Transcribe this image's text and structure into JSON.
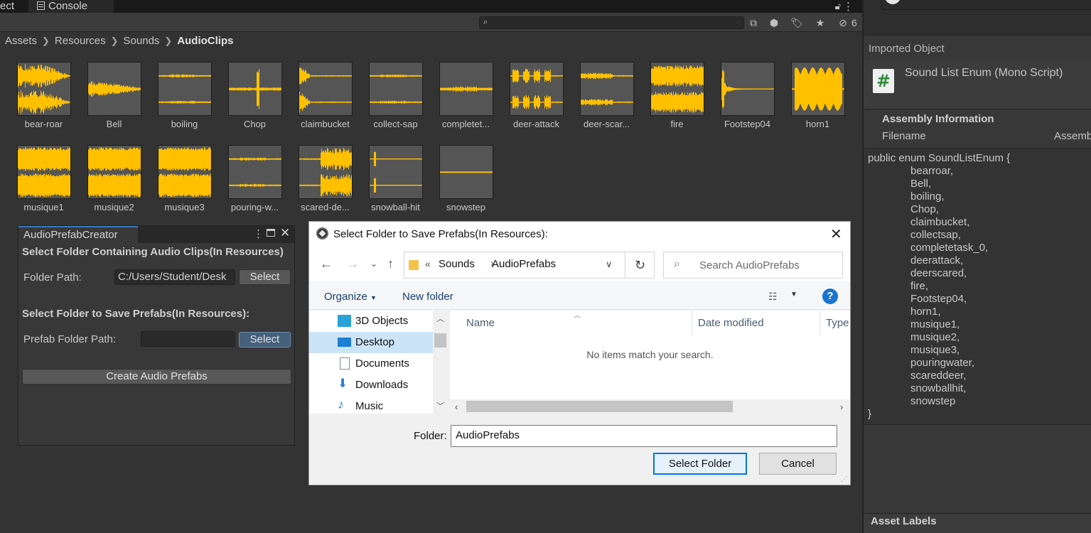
{
  "tabs": {
    "project": "ect",
    "console": "Console"
  },
  "toolbar": {
    "hidden_count": "6"
  },
  "breadcrumb": [
    "Assets",
    "Resources",
    "Sounds",
    "AudioClips"
  ],
  "audio_clips": [
    {
      "name": "bear-roar"
    },
    {
      "name": "Bell"
    },
    {
      "name": "boiling"
    },
    {
      "name": "Chop"
    },
    {
      "name": "claimbucket"
    },
    {
      "name": "collect-sap"
    },
    {
      "name": "completet..."
    },
    {
      "name": "deer-attack"
    },
    {
      "name": "deer-scar..."
    },
    {
      "name": "fire"
    },
    {
      "name": "Footstep04"
    },
    {
      "name": "horn1"
    },
    {
      "name": "musique1"
    },
    {
      "name": "musique2"
    },
    {
      "name": "musique3"
    },
    {
      "name": "pouring-w..."
    },
    {
      "name": "scared-de..."
    },
    {
      "name": "snowball-hit"
    },
    {
      "name": "snowstep"
    }
  ],
  "creator": {
    "tab": "AudioPrefabCreator",
    "heading1": "Select Folder Containing Audio Clips(In Resources)",
    "folder_label": "Folder Path:",
    "folder_value": "C:/Users/Student/Desk",
    "select1": "Select",
    "heading2": "Select Folder to Save Prefabs(In Resources):",
    "prefab_label": "Prefab Folder Path:",
    "prefab_value": "",
    "select2": "Select",
    "create": "Create Audio Prefabs"
  },
  "inspector": {
    "imported_object": "Imported Object",
    "script_title": "Sound List Enum (Mono Script)",
    "assembly_info": "Assembly Information",
    "filename": "Filename",
    "assembly_col": "Assemb",
    "code_open": "public enum SoundListEnum {",
    "code_items": [
      "bearroar,",
      "Bell,",
      "boiling,",
      "Chop,",
      "claimbucket,",
      "collectsap,",
      "completetask_0,",
      "deerattack,",
      "deerscared,",
      "fire,",
      "Footstep04,",
      "horn1,",
      "musique1,",
      "musique2,",
      "musique3,",
      "pouringwater,",
      "scareddeer,",
      "snowballhit,",
      "snowstep"
    ],
    "code_close": "}",
    "asset_labels": "Asset Labels"
  },
  "dialog": {
    "title": "Select Folder to Save Prefabs(In Resources):",
    "address": {
      "parent": "Sounds",
      "current": "AudioPrefabs"
    },
    "search_placeholder": "Search AudioPrefabs",
    "organize": "Organize",
    "new_folder": "New folder",
    "nav_items": [
      {
        "label": "3D Objects",
        "icon": "3d-objects-icon"
      },
      {
        "label": "Desktop",
        "icon": "desktop-icon"
      },
      {
        "label": "Documents",
        "icon": "documents-icon"
      },
      {
        "label": "Downloads",
        "icon": "downloads-icon"
      },
      {
        "label": "Music",
        "icon": "music-icon"
      }
    ],
    "columns": [
      "Name",
      "Date modified",
      "Type"
    ],
    "empty": "No items match your search.",
    "folder_label": "Folder:",
    "folder_value": "AudioPrefabs",
    "select_btn": "Select Folder",
    "cancel_btn": "Cancel"
  },
  "colors": {
    "waveform": "#ffc000",
    "accent": "#0078d7",
    "unity_bg": "#333333"
  }
}
